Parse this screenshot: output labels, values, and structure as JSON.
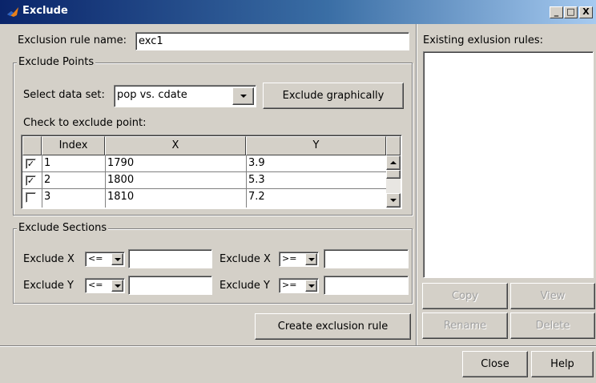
{
  "window": {
    "title": "Exclude",
    "minimize": "_",
    "maximize": "□",
    "close": "X"
  },
  "rule_name": {
    "label": "Exclusion rule name:",
    "value": "exc1"
  },
  "exclude_points": {
    "legend": "Exclude Points",
    "dataset_label": "Select data set:",
    "dataset_value": "pop vs. cdate",
    "exclude_graphically": "Exclude graphically",
    "check_label": "Check to exclude point:",
    "columns": [
      "Index",
      "X",
      "Y"
    ],
    "rows": [
      {
        "checked": true,
        "check": "✓",
        "index": "1",
        "x": "1790",
        "y": "3.9"
      },
      {
        "checked": true,
        "check": "✓",
        "index": "2",
        "x": "1800",
        "y": "5.3"
      },
      {
        "checked": false,
        "check": "",
        "index": "3",
        "x": "1810",
        "y": "7.2"
      }
    ]
  },
  "exclude_sections": {
    "legend": "Exclude Sections",
    "x_label": "Exclude X",
    "y_label": "Exclude Y",
    "x_min_op": "<=",
    "x_max_op": ">=",
    "y_min_op": "<=",
    "y_max_op": ">=",
    "x_min_value": "",
    "x_max_value": "",
    "y_min_value": "",
    "y_max_value": ""
  },
  "create_rule": "Create exclusion rule",
  "existing": {
    "label": "Existing exlusion rules:",
    "items": [],
    "copy": "Copy",
    "view": "View",
    "rename": "Rename",
    "delete": "Delete"
  },
  "footer": {
    "close": "Close",
    "help": "Help"
  },
  "colors": {
    "title_gradient_start": "#0a246a",
    "title_gradient_end": "#a6caf0",
    "face": "#d4d0c8"
  }
}
